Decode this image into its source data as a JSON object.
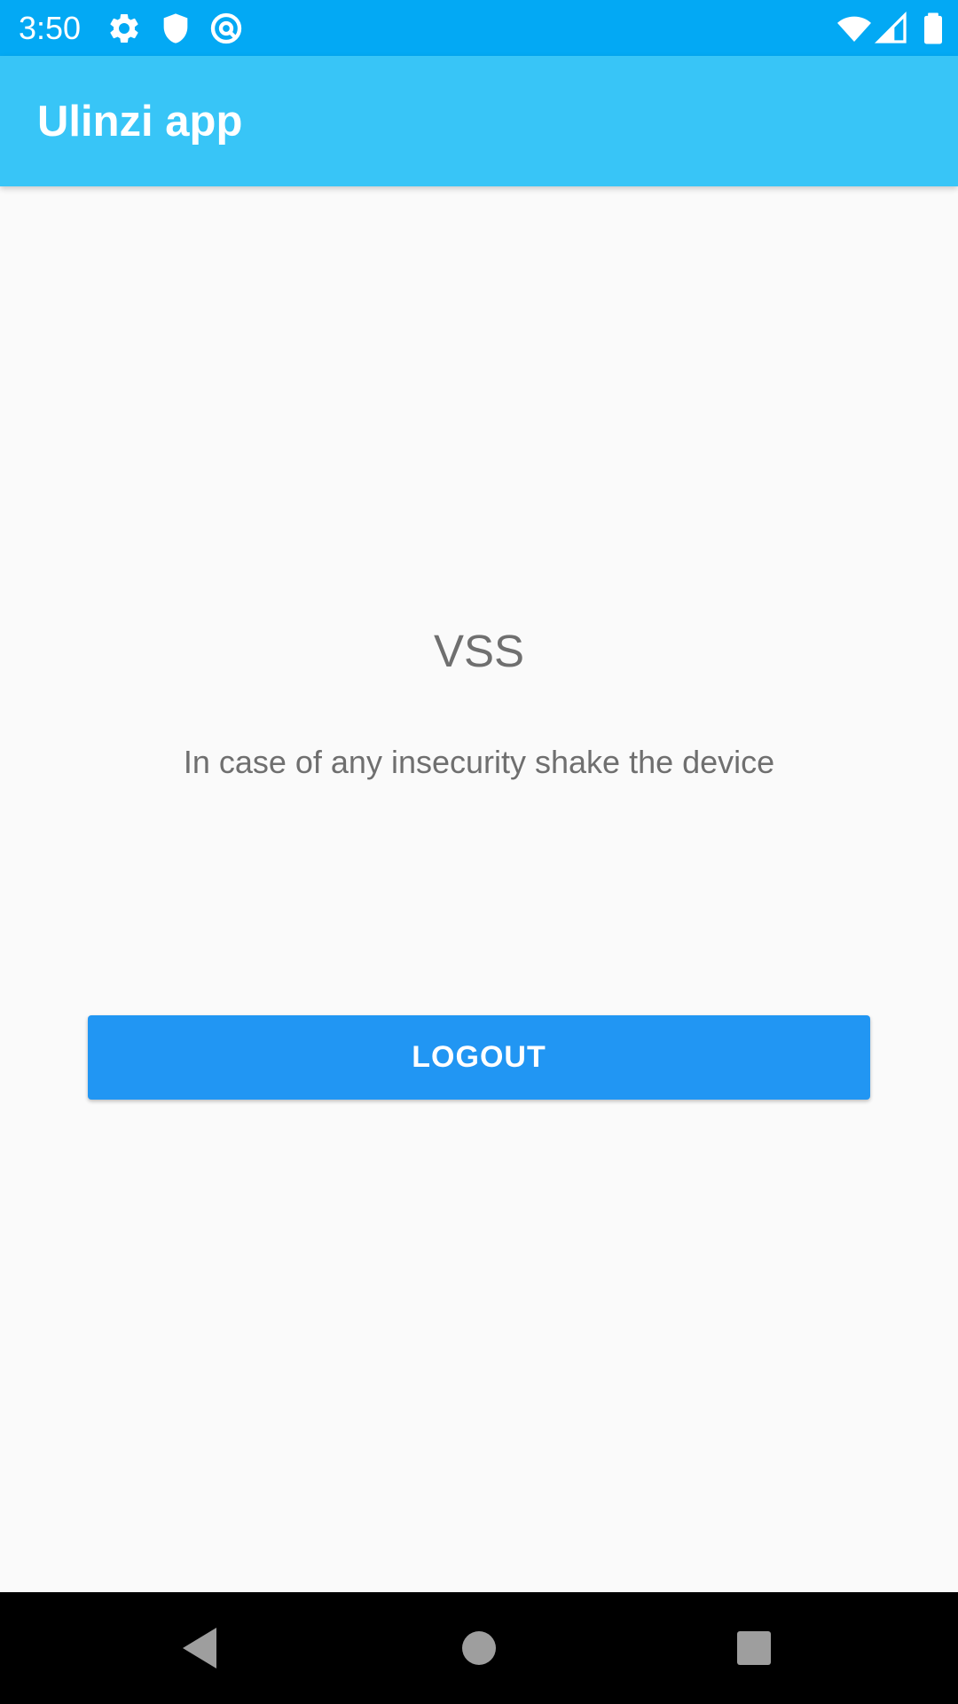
{
  "status_bar": {
    "time": "3:50",
    "icons": [
      "gear-icon",
      "shield-icon",
      "vpn-at-icon",
      "wifi-icon",
      "signal-icon",
      "battery-icon"
    ],
    "color": "#03a9f4"
  },
  "app_bar": {
    "title": "Ulinzi app",
    "color": "#38c5f7"
  },
  "main": {
    "title": "VSS",
    "subtitle": "In case of any insecurity shake the device",
    "logout_label": "LOGOUT",
    "button_color": "#2196f3"
  },
  "nav_bar": {
    "buttons": [
      "back-icon",
      "home-icon",
      "recents-icon"
    ]
  }
}
